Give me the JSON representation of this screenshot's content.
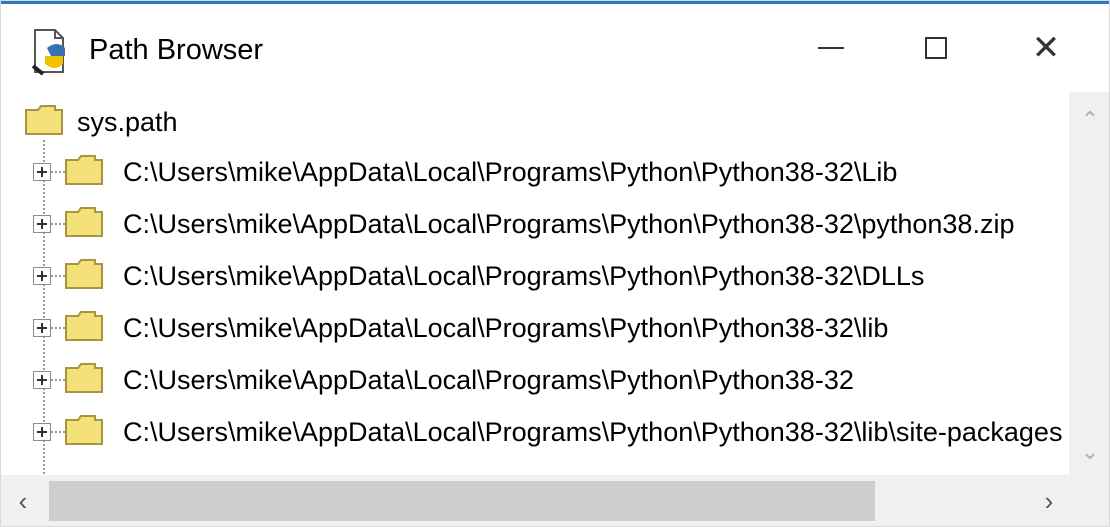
{
  "window": {
    "title": "Path Browser",
    "icon": "python-idle-icon",
    "controls": {
      "minimize": "minimize-icon",
      "maximize": "maximize-icon",
      "close": "close-icon",
      "close_glyph": "✕"
    }
  },
  "tree": {
    "root": {
      "label": "sys.path"
    },
    "items": [
      {
        "label": "C:\\Users\\mike\\AppData\\Local\\Programs\\Python\\Python38-32\\Lib"
      },
      {
        "label": "C:\\Users\\mike\\AppData\\Local\\Programs\\Python\\Python38-32\\python38.zip"
      },
      {
        "label": "C:\\Users\\mike\\AppData\\Local\\Programs\\Python\\Python38-32\\DLLs"
      },
      {
        "label": "C:\\Users\\mike\\AppData\\Local\\Programs\\Python\\Python38-32\\lib"
      },
      {
        "label": "C:\\Users\\mike\\AppData\\Local\\Programs\\Python\\Python38-32"
      },
      {
        "label": "C:\\Users\\mike\\AppData\\Local\\Programs\\Python\\Python38-32\\lib\\site-packages"
      }
    ]
  },
  "scrollbars": {
    "vertical": {
      "up_glyph": "⌃",
      "down_glyph": "⌄"
    },
    "horizontal": {
      "left_glyph": "‹",
      "right_glyph": "›"
    }
  },
  "colors": {
    "accent": "#2b78c4",
    "folder_fill": "#f4e17a",
    "folder_stroke": "#a89440"
  }
}
